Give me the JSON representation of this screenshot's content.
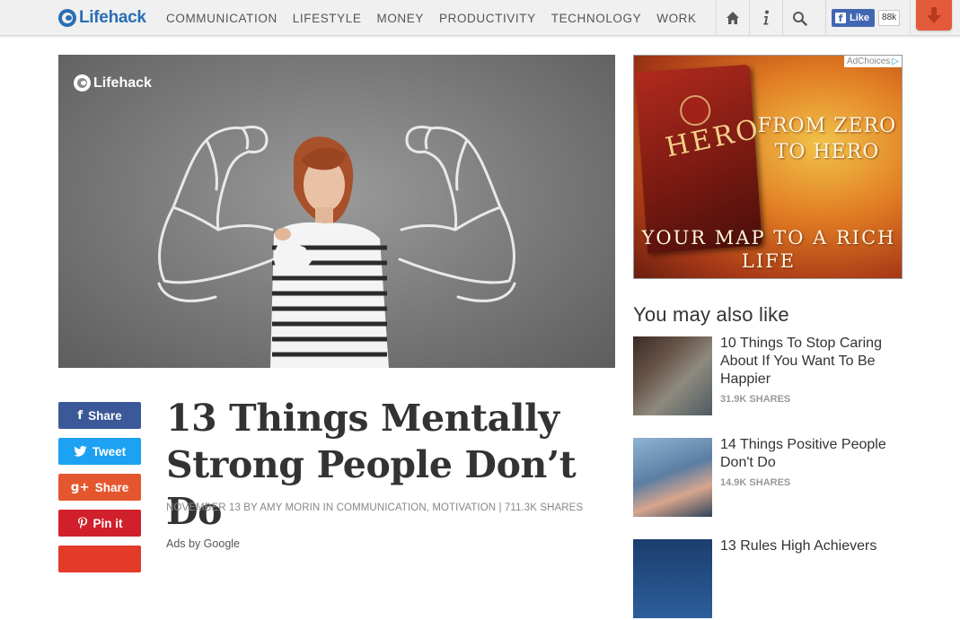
{
  "brand": {
    "name": "Lifehack",
    "color": "#2a6db5"
  },
  "nav": {
    "items": [
      "COMMUNICATION",
      "LIFESTYLE",
      "MONEY",
      "PRODUCTIVITY",
      "TECHNOLOGY",
      "WORK"
    ]
  },
  "toolbar": {
    "home_icon": "home-icon",
    "info_icon": "info-icon",
    "search_icon": "search-icon",
    "fb_like_label": "Like",
    "fb_like_count": "88k",
    "download_icon": "down-arrow-icon"
  },
  "hero": {
    "logo_text": "Lifehack"
  },
  "ad": {
    "choices_label": "AdChoices",
    "book_title": "HERO",
    "headline": "FROM ZERO TO HERO",
    "tagline": "YOUR MAP TO A RICH LIFE"
  },
  "share": {
    "facebook": "Share",
    "twitter": "Tweet",
    "googleplus": "Share",
    "pinterest": "Pin it"
  },
  "article": {
    "title": "13 Things Mentally Strong People Don’t Do",
    "meta": "NOVEMBER 13 BY AMY MORIN IN COMMUNICATION, MOTIVATION | 711.3K SHARES",
    "ads_by": "Ads by Google"
  },
  "sidebar": {
    "heading": "You may also like",
    "related": [
      {
        "title": "10 Things To Stop Caring About If You Want To Be Happier",
        "shares": "31.9K SHARES"
      },
      {
        "title": "14 Things Positive People Don't Do",
        "shares": "14.9K SHARES"
      },
      {
        "title": "13 Rules High Achievers",
        "shares": ""
      }
    ]
  },
  "colors": {
    "facebook": "#3b5998",
    "twitter": "#1da1f2",
    "googleplus": "#e4572e",
    "pinterest": "#d0202b",
    "download": "#e35b3a"
  }
}
